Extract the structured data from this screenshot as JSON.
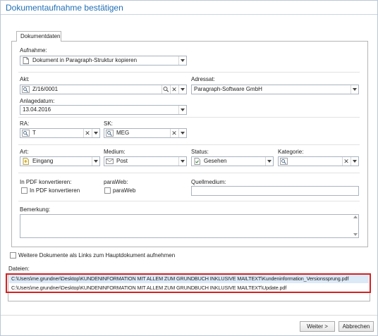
{
  "window": {
    "title": "Dokumentaufnahme bestätigen"
  },
  "tab": {
    "label": "Dokumentdaten"
  },
  "aufnahme": {
    "label": "Aufnahme:",
    "value": "Dokument in Paragraph-Struktur kopieren"
  },
  "akt": {
    "label": "Akt:",
    "value": "Z/16/0001"
  },
  "adressat": {
    "label": "Adressat:",
    "value": "Paragraph-Software GmbH"
  },
  "anlagedatum": {
    "label": "Anlagedatum:",
    "value": "13.04.2016"
  },
  "ra": {
    "label": "RA:",
    "value": "T"
  },
  "sk": {
    "label": "SK:",
    "value": "MEG"
  },
  "art": {
    "label": "Art:",
    "value": "Eingang"
  },
  "medium": {
    "label": "Medium:",
    "value": "Post"
  },
  "status": {
    "label": "Status:",
    "value": "Gesehen"
  },
  "kategorie": {
    "label": "Kategorie:",
    "value": ""
  },
  "pdf": {
    "label": "In PDF konvertieren:",
    "checkbox_label": "In PDF konvertieren",
    "checked": false
  },
  "paraweb": {
    "label": "paraWeb:",
    "checkbox_label": "paraWeb",
    "checked": false
  },
  "quellmedium": {
    "label": "Quellmedium:",
    "value": ""
  },
  "bemerkung": {
    "label": "Bemerkung:",
    "value": ""
  },
  "links_option": {
    "label": "Weitere Dokumente als Links zum Hauptdokument aufnehmen",
    "checked": false
  },
  "dateien": {
    "label": "Dateien:",
    "files": [
      "C:\\Users\\me.grundner\\Desktop\\KUNDENINFORMATION MIT ALLEM ZUM GRUNDBUCH INKLUSIVE MAILTEXT\\Kundeninformation_Versionssprung.pdf",
      "C:\\Users\\me.grundner\\Desktop\\KUNDENINFORMATION MIT ALLEM ZUM GRUNDBUCH INKLUSIVE MAILTEXT\\Update.pdf"
    ]
  },
  "buttons": {
    "next": "Weiter >",
    "cancel": "Abbrechen"
  },
  "colors": {
    "title": "#1f6fb5",
    "highlight_border": "#d32222",
    "selected_row": "#dce9f7"
  },
  "icons": [
    "document-icon",
    "search-box-icon",
    "search-icon",
    "clear-icon",
    "chevron-down-icon",
    "envelope-in-icon",
    "mail-icon",
    "status-icon"
  ]
}
